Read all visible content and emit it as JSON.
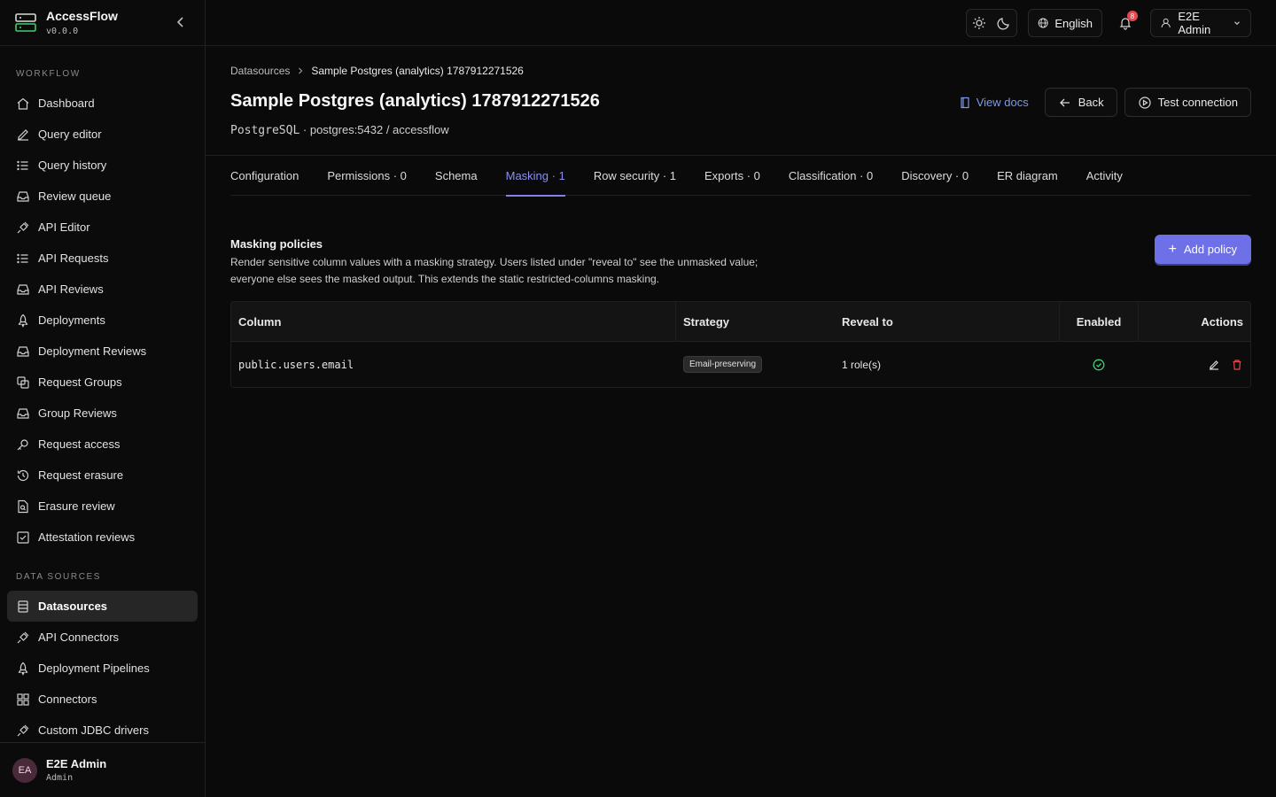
{
  "app": {
    "name": "AccessFlow",
    "version": "v0.0.0"
  },
  "sidebar": {
    "workflow_label": "WORKFLOW",
    "workflow_items": [
      {
        "label": "Dashboard",
        "icon": "home-icon"
      },
      {
        "label": "Query editor",
        "icon": "pencil-icon"
      },
      {
        "label": "Query history",
        "icon": "list-icon"
      },
      {
        "label": "Review queue",
        "icon": "inbox-icon"
      },
      {
        "label": "API Editor",
        "icon": "plug-icon"
      },
      {
        "label": "API Requests",
        "icon": "list-icon"
      },
      {
        "label": "API Reviews",
        "icon": "inbox-icon"
      },
      {
        "label": "Deployments",
        "icon": "rocket-icon"
      },
      {
        "label": "Deployment Reviews",
        "icon": "inbox-icon"
      },
      {
        "label": "Request Groups",
        "icon": "layers-icon"
      },
      {
        "label": "Group Reviews",
        "icon": "inbox-icon"
      },
      {
        "label": "Request access",
        "icon": "key-icon"
      },
      {
        "label": "Request erasure",
        "icon": "history-icon"
      },
      {
        "label": "Erasure review",
        "icon": "file-search-icon"
      },
      {
        "label": "Attestation reviews",
        "icon": "check-square-icon"
      }
    ],
    "datasources_label": "DATA SOURCES",
    "datasource_items": [
      {
        "label": "Datasources",
        "icon": "database-icon",
        "active": true
      },
      {
        "label": "API Connectors",
        "icon": "plug-icon"
      },
      {
        "label": "Deployment Pipelines",
        "icon": "rocket-icon"
      },
      {
        "label": "Connectors",
        "icon": "grid-icon"
      },
      {
        "label": "Custom JDBC drivers",
        "icon": "plug-icon"
      }
    ],
    "user": {
      "initials": "EA",
      "name": "E2E Admin",
      "role": "Admin"
    }
  },
  "topbar": {
    "language": "English",
    "notifications_count": "8",
    "user_label": "E2E Admin"
  },
  "breadcrumb": {
    "parent": "Datasources",
    "current": "Sample Postgres (analytics) 1787912271526"
  },
  "page": {
    "title": "Sample Postgres (analytics) 1787912271526",
    "subtitle_type": "PostgreSQL",
    "subtitle_rest": " · postgres:5432 / accessflow",
    "view_docs": "View docs",
    "back": "Back",
    "test_connection": "Test connection"
  },
  "tabs": [
    {
      "label": "Configuration"
    },
    {
      "label": "Permissions · 0"
    },
    {
      "label": "Schema"
    },
    {
      "label": "Masking · 1",
      "active": true
    },
    {
      "label": "Row security · 1"
    },
    {
      "label": "Exports · 0"
    },
    {
      "label": "Classification · 0"
    },
    {
      "label": "Discovery · 0"
    },
    {
      "label": "ER diagram"
    },
    {
      "label": "Activity"
    }
  ],
  "masking": {
    "title": "Masking policies",
    "description_line1": "Render sensitive column values with a masking strategy. Users listed under \"reveal to\" see the unmasked value;",
    "description_line2": "everyone else sees the masked output. This extends the static restricted-columns masking.",
    "add_label": "Add policy",
    "columns": {
      "column": "Column",
      "strategy": "Strategy",
      "reveal": "Reveal to",
      "enabled": "Enabled",
      "actions": "Actions"
    },
    "rows": [
      {
        "column": "public.users.email",
        "strategy": "Email-preserving",
        "reveal": "1 role(s)",
        "enabled": true
      }
    ]
  },
  "colors": {
    "accent": "#6d70e6",
    "tab_active": "#8b8ff0",
    "link": "#7f97e8",
    "success": "#3ecf6e",
    "danger": "#e5484d"
  }
}
